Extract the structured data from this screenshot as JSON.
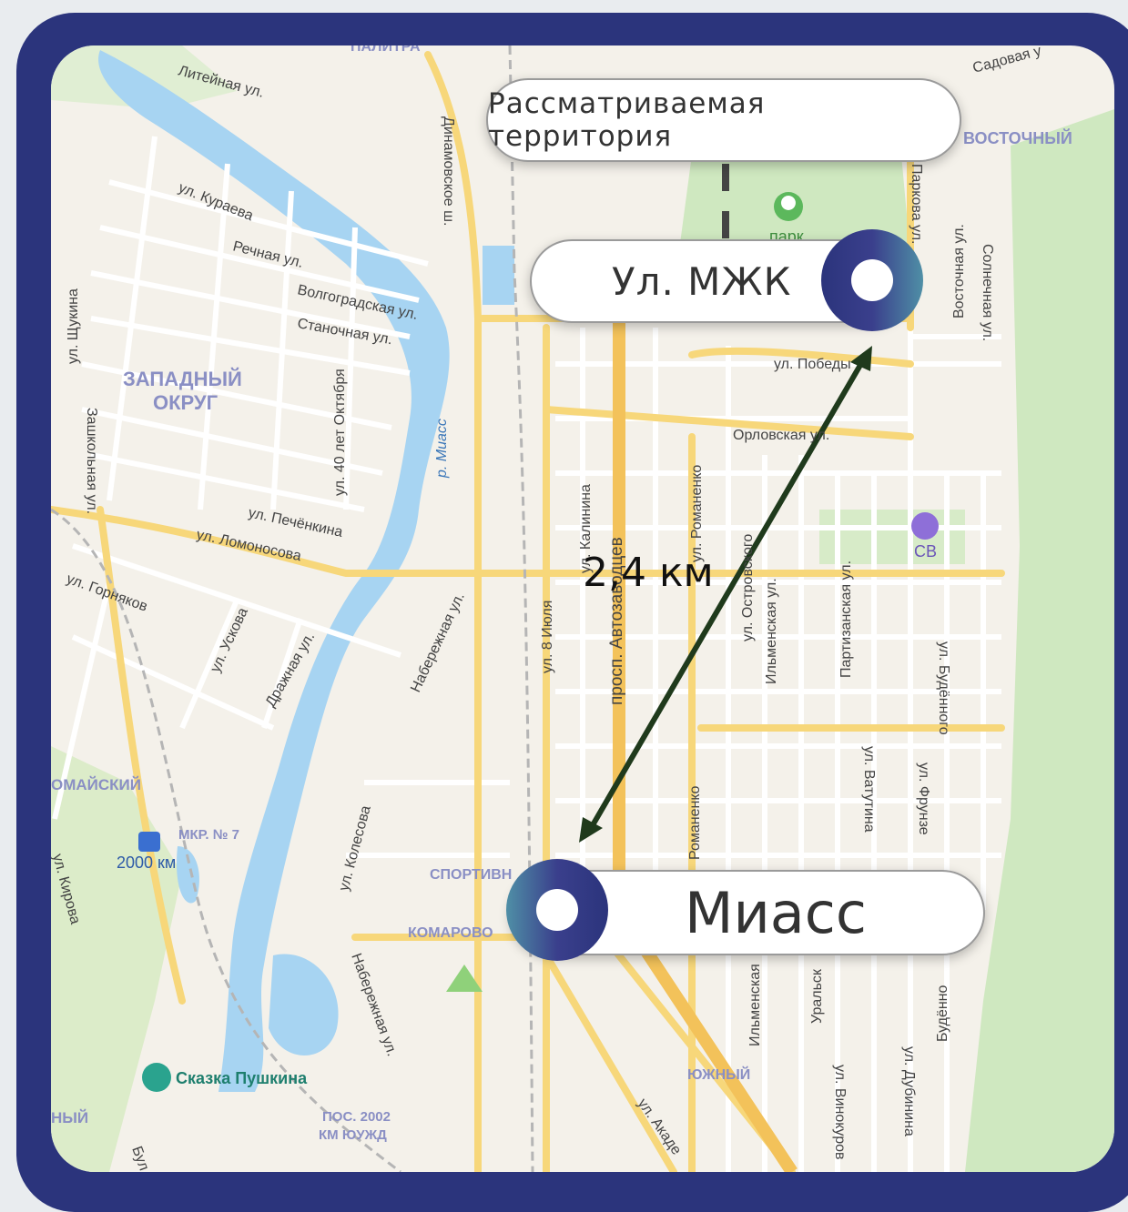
{
  "colors": {
    "frame": "#2b347c",
    "map_bg": "#f4f1ea",
    "water": "#a7d4f2",
    "park": "#cfe8c0",
    "major_road": "#f7d77a",
    "arrow": "#1f3a1c"
  },
  "callouts": {
    "territory": "Рассматриваемая территория",
    "start": "Ул. МЖК",
    "end": "Миасс",
    "distance": "2,4 км"
  },
  "map_labels": {
    "districts": [
      "ЗАПАДНЫЙ",
      "ОКРУГ",
      "ВОСТОЧНЫЙ",
      "ОМАЙСКИЙ",
      "МКР. № 7",
      "СПОРТИВН",
      "КОМАРОВО",
      "ЮЖНЫЙ",
      "ПОС. 2002",
      "КМ ЮУЖД",
      "НЫЙ",
      "ПАЛИТРА"
    ],
    "streets": [
      "Литейная ул.",
      "ул. Кураева",
      "Речная ул.",
      "Волгоградская ул.",
      "Станочная ул.",
      "ул. Щукина",
      "Динамовское ш.",
      "ул. 40 лет Октября",
      "р. Миасс",
      "ул. Печёнкина",
      "ул. Ломоносова",
      "ул. Горняков",
      "ул. Ускова",
      "Дражная ул.",
      "Набережная ул.",
      "ул. Калинина",
      "просп. Автозаводцев",
      "ул. 8 Июля",
      "ул. Романенко",
      "ул. Островского",
      "Ильменская ул.",
      "Партизанская ул.",
      "ул. Будённого",
      "ул. Победы",
      "Орловская ул.",
      "Восточная ул.",
      "Солнечная ул.",
      "Садовая у",
      "ул. Ватутина",
      "ул. Фрунзе",
      "ул. Колесова",
      "Набережная ул.",
      "Романенко",
      "Ильменская",
      "Уральск",
      "Будённо",
      "ул. Винокуров",
      "ул. Дубинина",
      "ул. Акаде",
      "ул. Кирова",
      "Зашкольная ул.",
      "Паркова ул.",
      "Бул"
    ],
    "pois": [
      "парк",
      "СВ",
      "2000 км",
      "Сказка Пушкина"
    ]
  }
}
